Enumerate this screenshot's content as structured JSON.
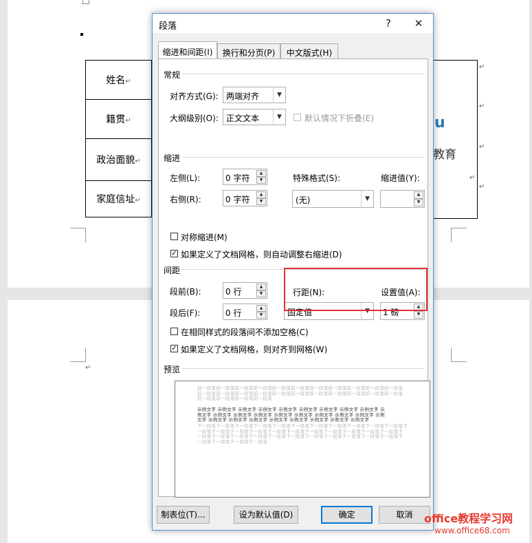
{
  "document": {
    "table_rows": [
      "姓名",
      "籍贯",
      "政治面貌",
      "家庭信址"
    ],
    "para_mark": "↵",
    "logo_fragment": [
      "u",
      "教育"
    ]
  },
  "dialog": {
    "title": "段落",
    "help": "?",
    "close": "✕",
    "tabs": [
      "缩进和间距(I)",
      "换行和分页(P)",
      "中文版式(H)"
    ],
    "general": {
      "section": "常规",
      "alignment_label": "对齐方式(G):",
      "alignment_value": "两端对齐",
      "outline_label": "大纲级别(O):",
      "outline_value": "正文文本",
      "collapse_label": "默认情况下折叠(E)"
    },
    "indent": {
      "section": "缩进",
      "left_label": "左侧(L):",
      "left_value": "0 字符",
      "right_label": "右侧(R):",
      "right_value": "0 字符",
      "special_label": "特殊格式(S):",
      "special_value": "(无)",
      "indent_by_label": "缩进值(Y):",
      "indent_by_value": "",
      "mirror_label": "对称缩进(M)",
      "auto_adjust_label": "如果定义了文档网格，则自动调整右缩进(D)"
    },
    "spacing": {
      "section": "间距",
      "before_label": "段前(B):",
      "before_value": "0 行",
      "after_label": "段后(F):",
      "after_value": "0 行",
      "line_label": "行距(N):",
      "line_value": "固定值",
      "at_label": "设置值(A):",
      "at_value": "1 磅",
      "no_space_label": "在相同样式的段落间不添加空格(C)",
      "snap_grid_label": "如果定义了文档网格，则对齐到网格(W)"
    },
    "preview": {
      "section": "预览",
      "prev_lines": [
        "前一段落前一段落前一段落前一段落前一段落前一段落前一段落前一段落前一段落前一段落前一段落",
        "前一段落前一段落前一段落前一段落前一段落前一段落前一段落前一段落前一段落前一段落前一段落",
        "前一段落前一段落前一段落前一段落"
      ],
      "sample_lines": [
        "示例文字 示例文字 示例文字 示例文字 示例文字 示例文字 示例文字 示例文字 示例文字 示",
        "例文字 示例文字 示例文字 示例文字 示例文字 示例文字 示例文字 示例文字 示例文字 示例",
        "文字 示例文字 示例文字 示例文字 示例文字 示例文字 示例文字 示例文字 示例文字"
      ],
      "next_lines": [
        "下一段落下一段落下一段落下一段落下一段落下一段落下一段落下一段落下一段落下一段落下一段落下",
        "一段落下一段落下一段落下一段落下一段落下一段落下一段落下一段落下一段落下一段落下一段落下",
        "一段落下一段落下一段落下一段落下一段落下一段落下一段落下一段落下一段落下一段落下一段落下",
        "一段落下一段落下一段落下一段落"
      ]
    },
    "buttons": {
      "tabs": "制表位(T)...",
      "set_default": "设为默认值(D)",
      "ok": "确定",
      "cancel": "取消"
    }
  },
  "watermark": {
    "line1": "office教程学习网",
    "line2": "www.office68.com"
  }
}
